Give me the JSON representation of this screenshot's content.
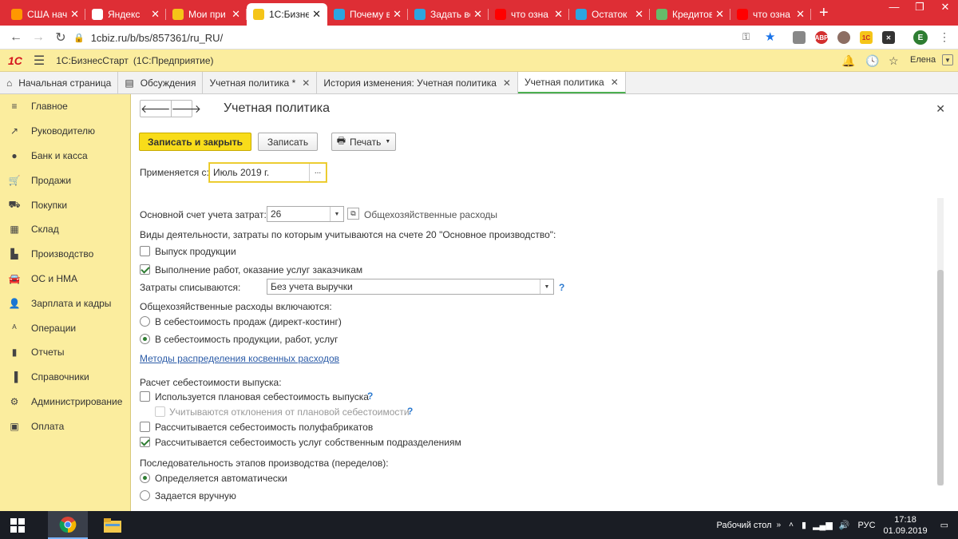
{
  "browser": {
    "tabs": [
      {
        "title": "США нач",
        "icon": "at-icon",
        "color": "#ff9800"
      },
      {
        "title": "Яндекс",
        "icon": "blank-icon",
        "color": "#ffffff"
      },
      {
        "title": "Мои при",
        "icon": "1c-icon",
        "color": "#f5c518"
      },
      {
        "title": "1С:Бизнес",
        "icon": "1c-icon",
        "color": "#f5c518",
        "active": true
      },
      {
        "title": "Почему в",
        "icon": "telegram-icon",
        "color": "#2ca5e0"
      },
      {
        "title": "Задать во",
        "icon": "telegram-icon",
        "color": "#2ca5e0"
      },
      {
        "title": "что озна",
        "icon": "yandex-icon",
        "color": "#ff0000"
      },
      {
        "title": "Остаток",
        "icon": "telegram-icon",
        "color": "#2ca5e0"
      },
      {
        "title": "Кредитов",
        "icon": "green-circle-icon",
        "color": "#66bb6a"
      },
      {
        "title": "что озна",
        "icon": "yandex-icon",
        "color": "#ff0000"
      }
    ],
    "url": "1cbiz.ru/b/bs/857361/ru_RU/",
    "profile_letter": "E"
  },
  "app": {
    "name": "1С:БизнесСтарт",
    "platform": "(1С:Предприятие)",
    "user": "Елена"
  },
  "page_tabs": [
    {
      "label": "Начальная страница",
      "icon": "home-icon"
    },
    {
      "label": "Обсуждения",
      "icon": "discussion-icon"
    },
    {
      "label": "Учетная политика *",
      "closable": true
    },
    {
      "label": "История изменения: Учетная политика",
      "closable": true
    },
    {
      "label": "Учетная политика",
      "closable": true,
      "current": true
    }
  ],
  "sidebar": [
    {
      "label": "Главное",
      "icon": "menu-lines-icon"
    },
    {
      "label": "Руководителю",
      "icon": "chart-line-icon"
    },
    {
      "label": "Банк и касса",
      "icon": "coin-icon"
    },
    {
      "label": "Продажи",
      "icon": "cart-icon"
    },
    {
      "label": "Покупки",
      "icon": "truck-icon"
    },
    {
      "label": "Склад",
      "icon": "grid-icon"
    },
    {
      "label": "Производство",
      "icon": "factory-icon"
    },
    {
      "label": "ОС и НМА",
      "icon": "car-icon"
    },
    {
      "label": "Зарплата и кадры",
      "icon": "person-icon"
    },
    {
      "label": "Операции",
      "icon": "dt-kt-icon"
    },
    {
      "label": "Отчеты",
      "icon": "bar-chart-icon"
    },
    {
      "label": "Справочники",
      "icon": "book-icon"
    },
    {
      "label": "Администрирование",
      "icon": "gear-icon"
    },
    {
      "label": "Оплата",
      "icon": "wallet-icon"
    }
  ],
  "form": {
    "title": "Учетная политика",
    "save_close": "Записать и закрыть",
    "save": "Записать",
    "print": "Печать",
    "applies_label": "Применяется с:",
    "applies_value": "Июль 2019 г.",
    "account_label": "Основной счет учета затрат:",
    "account_value": "26",
    "account_note": "Общехозяйственные расходы",
    "activities_label": "Виды деятельности, затраты по которым учитываются на счете 20 \"Основное производство\":",
    "chk_products": "Выпуск продукции",
    "chk_services": "Выполнение работ, оказание услуг заказчикам",
    "writeoff_label": "Затраты списываются:",
    "writeoff_value": "Без учета выручки",
    "overhead_label": "Общехозяйственные расходы включаются:",
    "radio_direct": "В себестоимость продаж (директ-костинг)",
    "radio_cost": "В  себестоимость продукции, работ, услуг",
    "methods_link": "Методы распределения косвенных расходов",
    "calc_label": "Расчет себестоимости выпуска:",
    "chk_planned": "Используется плановая себестоимость выпуска",
    "chk_deviation": "Учитываются отклонения от плановой себестоимости",
    "chk_semi": "Рассчитывается себестоимость полуфабрикатов",
    "chk_own": "Рассчитывается себестоимость услуг собственным подразделениям",
    "sequence_label": "Последовательность этапов производства (переделов):",
    "radio_auto": "Определяется автоматически",
    "radio_manual": "Задается вручную",
    "help": "?"
  },
  "taskbar": {
    "desktop": "Рабочий стол",
    "lang": "РУС",
    "time": "17:18",
    "date": "01.09.2019"
  }
}
